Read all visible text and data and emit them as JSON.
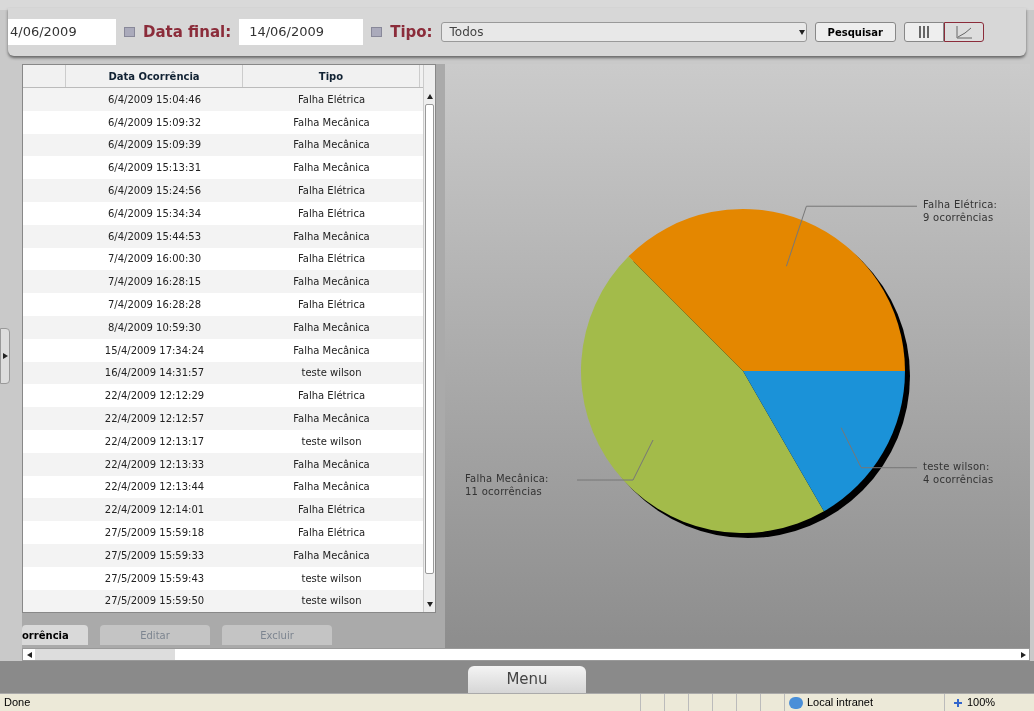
{
  "filter": {
    "start_date": "4/06/2009",
    "end_label": "Data final:",
    "end_date": "14/06/2009",
    "type_label": "Tipo:",
    "type_value": "Todos",
    "search_button": "Pesquisar",
    "views": [
      {
        "kind": "grid",
        "selected": false
      },
      {
        "kind": "chart",
        "selected": true
      }
    ]
  },
  "table": {
    "columns": [
      "Data Ocorrência",
      "Tipo"
    ],
    "rows": [
      [
        "6/4/2009 15:04:46",
        "Falha Elétrica"
      ],
      [
        "6/4/2009 15:09:32",
        "Falha Mecânica"
      ],
      [
        "6/4/2009 15:09:39",
        "Falha Mecânica"
      ],
      [
        "6/4/2009 15:13:31",
        "Falha Mecânica"
      ],
      [
        "6/4/2009 15:24:56",
        "Falha Elétrica"
      ],
      [
        "6/4/2009 15:34:34",
        "Falha Elétrica"
      ],
      [
        "6/4/2009 15:44:53",
        "Falha Mecânica"
      ],
      [
        "7/4/2009 16:00:30",
        "Falha Elétrica"
      ],
      [
        "7/4/2009 16:28:15",
        "Falha Mecânica"
      ],
      [
        "7/4/2009 16:28:28",
        "Falha Elétrica"
      ],
      [
        "8/4/2009 10:59:30",
        "Falha Mecânica"
      ],
      [
        "15/4/2009 17:34:24",
        "Falha Mecânica"
      ],
      [
        "16/4/2009 14:31:57",
        "teste wilson"
      ],
      [
        "22/4/2009 12:12:29",
        "Falha Elétrica"
      ],
      [
        "22/4/2009 12:12:57",
        "Falha Mecânica"
      ],
      [
        "22/4/2009 12:13:17",
        "teste wilson"
      ],
      [
        "22/4/2009 12:13:33",
        "Falha Mecânica"
      ],
      [
        "22/4/2009 12:13:44",
        "Falha Mecânica"
      ],
      [
        "22/4/2009 12:14:01",
        "Falha Elétrica"
      ],
      [
        "27/5/2009 15:59:18",
        "Falha Elétrica"
      ],
      [
        "27/5/2009 15:59:33",
        "Falha Mecânica"
      ],
      [
        "27/5/2009 15:59:43",
        "teste wilson"
      ],
      [
        "27/5/2009 15:59:50",
        "teste wilson"
      ]
    ]
  },
  "actions": [
    {
      "label": "orrência",
      "disabled": false
    },
    {
      "label": "Editar",
      "disabled": true
    },
    {
      "label": "Excluir",
      "disabled": true
    }
  ],
  "chart": {
    "chart_data": {
      "type": "pie",
      "categories": [
        "Falha Elétrica",
        "Falha Mecânica",
        "teste wilson"
      ],
      "series": [
        {
          "values": [
            37.5,
            45.83,
            16.67
          ]
        }
      ],
      "colors": [
        "#e48700",
        "#a3bb4a",
        "#1b92d8"
      ],
      "value_labels": [
        "9 ocorrências",
        "11 ocorrências",
        "4 ocorrências"
      ]
    },
    "label_separators": [
      ":",
      ":",
      ":"
    ]
  },
  "menu_tab": "Menu",
  "status_bar": {
    "text": "Done",
    "zone": "Local intranet",
    "zoom": "100%"
  }
}
